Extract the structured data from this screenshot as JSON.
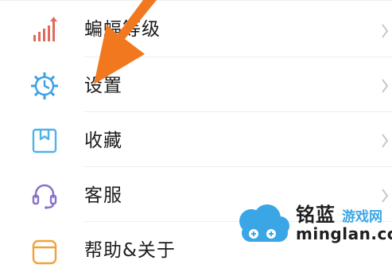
{
  "menu": {
    "items": [
      {
        "label": "蝙蝠等级",
        "icon": "level-chart-icon"
      },
      {
        "label": "设置",
        "icon": "settings-gear-icon"
      },
      {
        "label": "收藏",
        "icon": "bookmark-icon"
      },
      {
        "label": "客服",
        "icon": "headset-icon"
      },
      {
        "label": "帮助&关于",
        "icon": "help-icon"
      }
    ]
  },
  "annotation": {
    "icon": "pointer-arrow-icon",
    "color": "#f2781f"
  },
  "watermark": {
    "brand": "铭蓝",
    "tagline": "游戏网",
    "url": "minglan.cc",
    "logo_icon": "cloud-gamepad-logo-icon"
  },
  "colors": {
    "level_icon": "#e06a5b",
    "settings_icon": "#3ba0e6",
    "bookmark_icon": "#4fb2e8",
    "headset_icon": "#8a6fc9",
    "help_icon": "#f0a23a",
    "chevron": "#c8c8c8"
  }
}
